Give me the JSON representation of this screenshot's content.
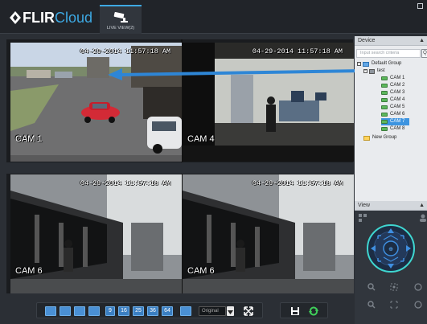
{
  "app": {
    "logo_flir": "FLIR",
    "logo_cloud": "Cloud",
    "live_tab_label": "LIVE VIEW(2)"
  },
  "video": {
    "tiles": [
      {
        "name": "CAM 1",
        "timestamp": "04-29-2014 11:57:18 AM"
      },
      {
        "name": "CAM 4",
        "timestamp": "04-29-2014 11:57:18 AM"
      },
      {
        "name": "CAM 6",
        "timestamp": "04-29-2014 11:57:18 AM"
      },
      {
        "name": "CAM 6",
        "timestamp": "04-29-2014 11:57:18 AM"
      }
    ]
  },
  "toolbar": {
    "layout_numbers": [
      "9",
      "16",
      "25",
      "36",
      "64"
    ],
    "stream_select": "Original"
  },
  "device_panel": {
    "header": "Device",
    "search_placeholder": "Input search criteria",
    "tree": {
      "default_group": "Default Group",
      "device": "test",
      "cameras": [
        "CAM 1",
        "CAM 2",
        "CAM 3",
        "CAM 4",
        "CAM 5",
        "CAM 6",
        "CAM 7",
        "CAM 8"
      ],
      "selected_camera": "CAM 7",
      "new_group": "New Group"
    }
  },
  "view_panel": {
    "header": "View"
  },
  "colors": {
    "accent": "#3da9e3",
    "ptz_ring": "#3fd6d0",
    "arrow": "#2e86d6"
  }
}
